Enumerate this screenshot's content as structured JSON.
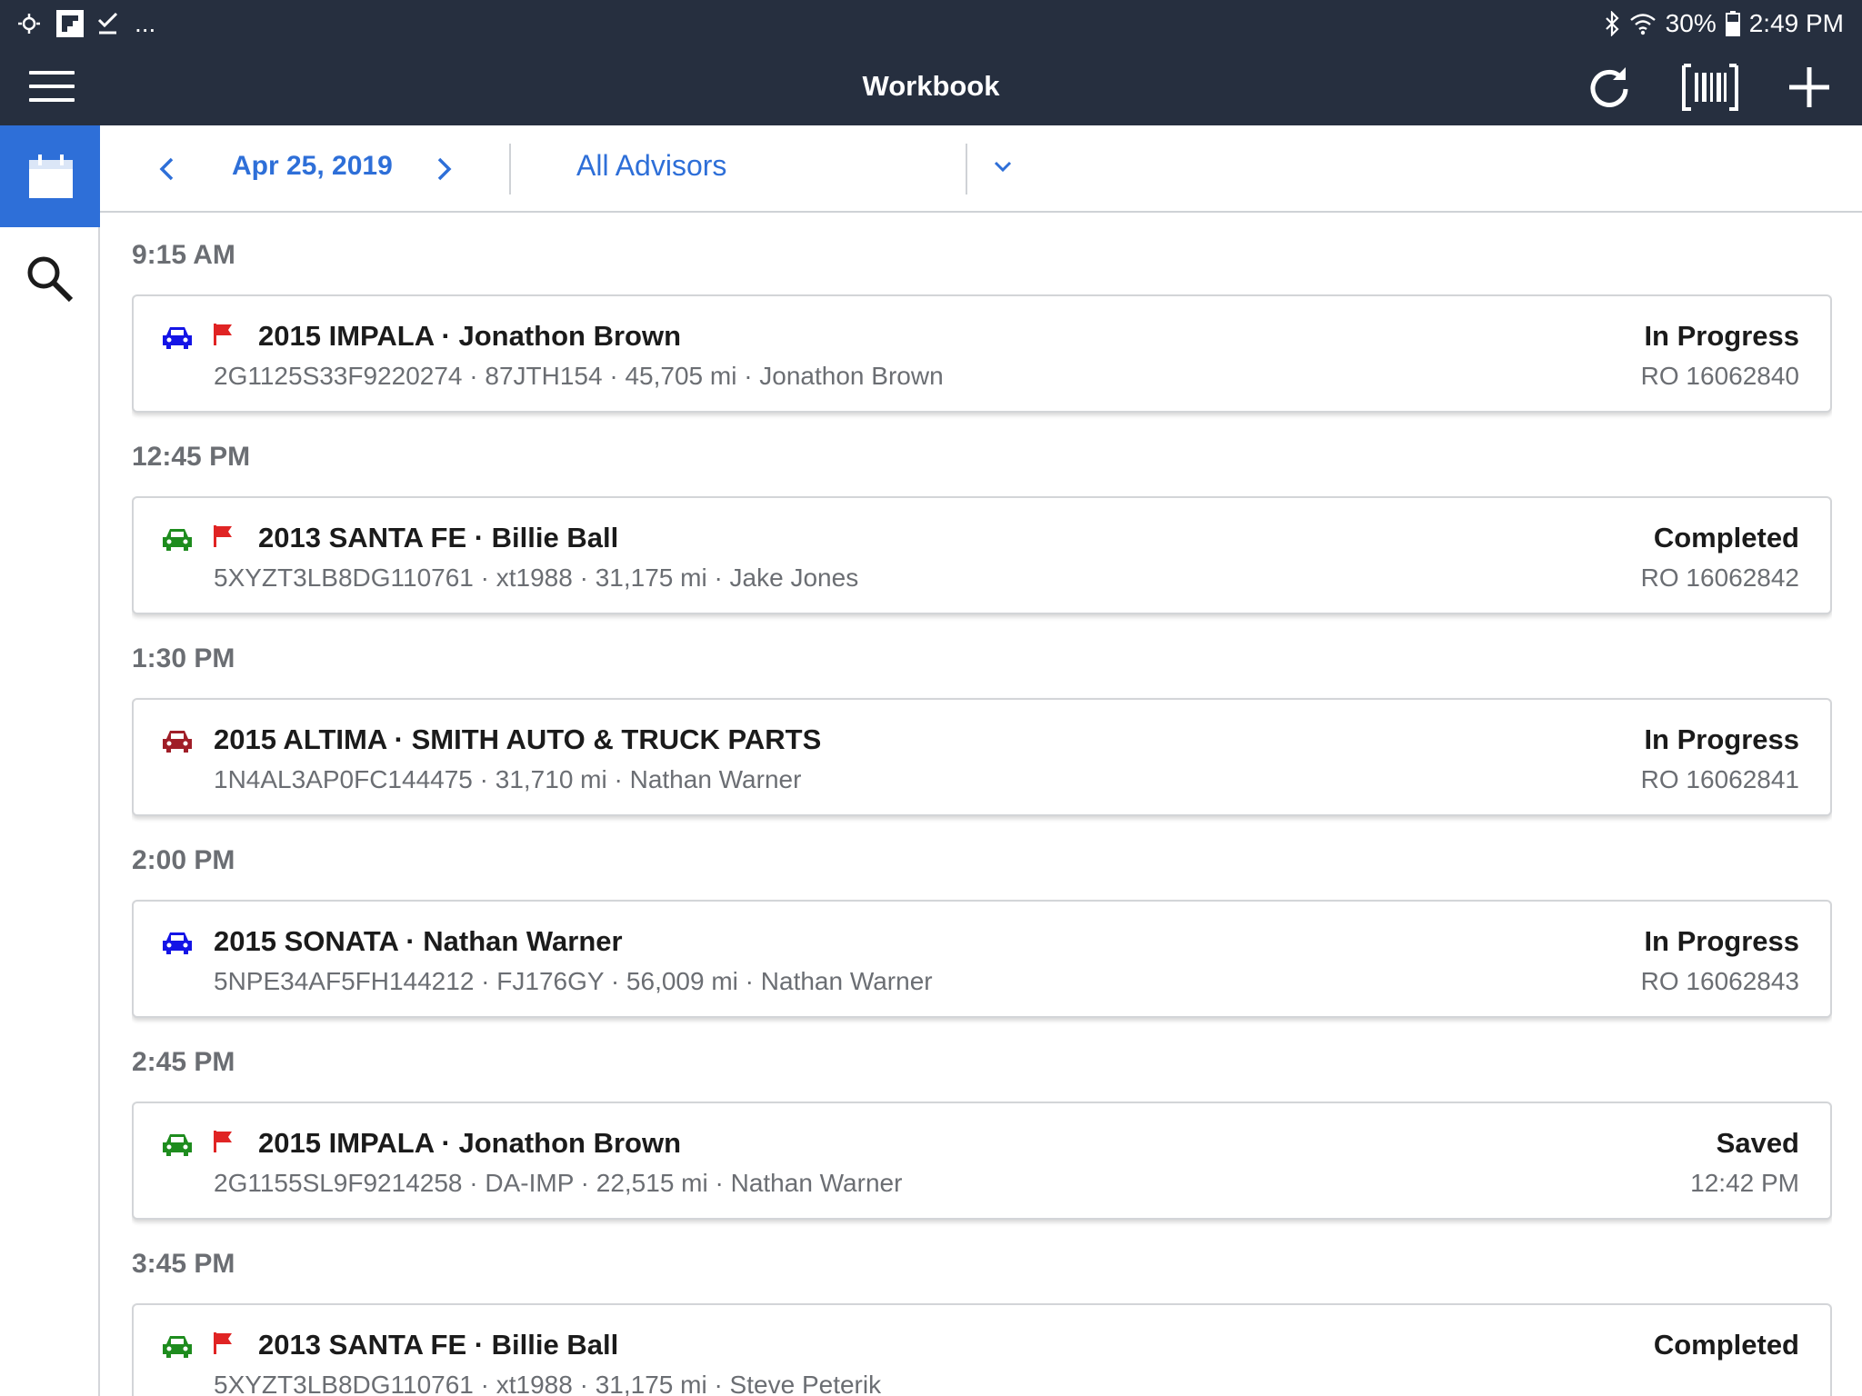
{
  "status_bar": {
    "left_overflow": "...",
    "battery": "30%",
    "time": "2:49 PM"
  },
  "toolbar": {
    "title": "Workbook",
    "icons": [
      "menu-icon",
      "refresh-icon",
      "barcode-scan-icon",
      "plus-icon"
    ]
  },
  "side_rail": {
    "items": [
      "calendar-icon",
      "search-icon"
    ],
    "active": "calendar",
    "active_color": "#2e6fd8"
  },
  "filter": {
    "date": "Apr 25, 2019",
    "advisor": "All Advisors"
  },
  "colors": {
    "header_bg": "#262f3f",
    "accent": "#2e6fd8",
    "car_blue": "#1414e6",
    "car_green": "#1e8c1e",
    "car_red": "#a01e28",
    "flag_red": "#e02424"
  },
  "appointments": [
    {
      "time": "9:15 AM",
      "car_color": "blue",
      "flagged": true,
      "title": "2015 IMPALA · Jonathon Brown",
      "details": "2G1125S33F9220274 · 87JTH154 · 45,705 mi · Jonathon Brown",
      "status": "In Progress",
      "ro": "RO 16062840"
    },
    {
      "time": "12:45 PM",
      "car_color": "green",
      "flagged": true,
      "title": "2013 SANTA FE · Billie Ball",
      "details": "5XYZT3LB8DG110761 · xt1988 · 31,175 mi · Jake Jones",
      "status": "Completed",
      "ro": "RO 16062842"
    },
    {
      "time": "1:30 PM",
      "car_color": "red",
      "flagged": false,
      "title": "2015 ALTIMA ·  SMITH AUTO & TRUCK PARTS",
      "details": "1N4AL3AP0FC144475 · 31,710 mi · Nathan Warner",
      "status": "In Progress",
      "ro": "RO 16062841"
    },
    {
      "time": "2:00 PM",
      "car_color": "blue",
      "flagged": false,
      "title": "2015 SONATA · Nathan Warner",
      "details": "5NPE34AF5FH144212 · FJ176GY · 56,009 mi · Nathan Warner",
      "status": "In Progress",
      "ro": "RO 16062843"
    },
    {
      "time": "2:45 PM",
      "car_color": "green",
      "flagged": true,
      "title": "2015 IMPALA · Jonathon Brown",
      "details": "2G1155SL9F9214258 · DA-IMP · 22,515 mi · Nathan Warner",
      "status": "Saved",
      "ro": "12:42 PM"
    },
    {
      "time": "3:45 PM",
      "car_color": "green",
      "flagged": true,
      "title": "2013 SANTA FE · Billie Ball",
      "details": "5XYZT3LB8DG110761 · xt1988 · 31,175 mi · Steve Peterik",
      "status": "Completed",
      "ro": ""
    }
  ]
}
